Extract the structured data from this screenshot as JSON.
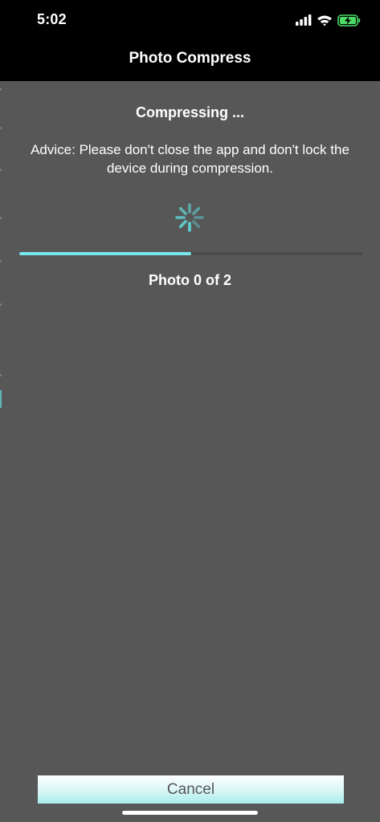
{
  "status_bar": {
    "time": "5:02",
    "icons": [
      "signal-icon",
      "wifi-icon",
      "battery-charging-icon"
    ]
  },
  "nav": {
    "title": "Photo Compress"
  },
  "main": {
    "heading": "Compressing ...",
    "advice": "Advice: Please don't close the app and don't lock the device during compression.",
    "progress": 0.5,
    "photo_count": "Photo 0 of 2"
  },
  "footer": {
    "cancel_label": "Cancel"
  },
  "colors": {
    "background": "#575757",
    "nav_background": "#000000",
    "accent": "#78e7ee",
    "spinner": "#5fd0d3",
    "battery": "#4cd964"
  }
}
